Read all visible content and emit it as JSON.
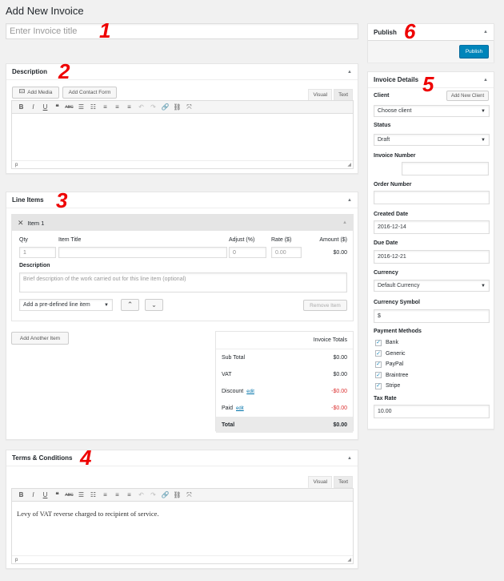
{
  "page_title": "Add New Invoice",
  "title_input": {
    "placeholder": "Enter Invoice title"
  },
  "annotations": [
    "1",
    "2",
    "3",
    "4",
    "5",
    "6"
  ],
  "description": {
    "heading": "Description",
    "add_media": "Add Media",
    "add_contact_form": "Add Contact Form",
    "tab_visual": "Visual",
    "tab_text": "Text",
    "status_path": "p"
  },
  "line_items": {
    "heading": "Line Items",
    "item_label": "Item 1",
    "col_qty": "Qty",
    "col_title": "Item Title",
    "col_adjust": "Adjust (%)",
    "col_rate": "Rate ($)",
    "col_amount": "Amount ($)",
    "qty_value": "1",
    "adjust_value": "0",
    "rate_placeholder": "0.00",
    "amount_value": "$0.00",
    "desc_label": "Description",
    "desc_placeholder": "Brief description of the work carried out for this line item (optional)",
    "predefined_select": "Add a pre-defined line item",
    "remove_item": "Remove Item",
    "add_another": "Add Another Item"
  },
  "totals": {
    "heading": "Invoice Totals",
    "sub_total_label": "Sub Total",
    "sub_total_value": "$0.00",
    "vat_label": "VAT",
    "vat_value": "$0.00",
    "discount_label": "Discount",
    "discount_edit": "edit",
    "discount_value": "-$0.00",
    "paid_label": "Paid",
    "paid_edit": "edit",
    "paid_value": "-$0.00",
    "total_label": "Total",
    "total_value": "$0.00"
  },
  "terms": {
    "heading": "Terms & Conditions",
    "tab_visual": "Visual",
    "tab_text": "Text",
    "content": "Levy of VAT reverse charged to recipient of service.",
    "status_path": "p"
  },
  "publish": {
    "heading": "Publish",
    "button": "Publish"
  },
  "invoice_details": {
    "heading": "Invoice Details",
    "client_label": "Client",
    "add_client": "Add New Client",
    "client_select": "Choose client",
    "status_label": "Status",
    "status_select": "Draft",
    "invoice_number_label": "Invoice Number",
    "order_number_label": "Order Number",
    "created_label": "Created Date",
    "created_value": "2016-12-14",
    "due_label": "Due Date",
    "due_value": "2016-12-21",
    "currency_label": "Currency",
    "currency_select": "Default Currency",
    "symbol_label": "Currency Symbol",
    "symbol_value": "$",
    "payment_label": "Payment Methods",
    "methods": [
      "Bank",
      "Generic",
      "PayPal",
      "Braintree",
      "Stripe"
    ],
    "tax_label": "Tax Rate",
    "tax_value": "10.00"
  }
}
